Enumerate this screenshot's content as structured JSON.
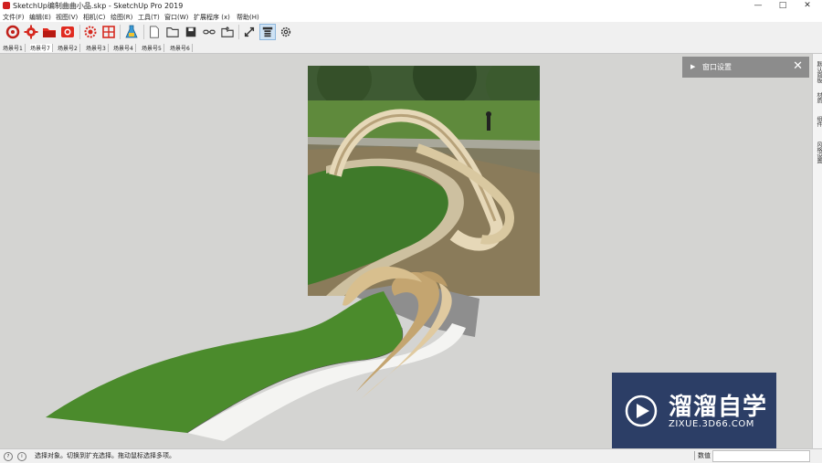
{
  "window": {
    "title": "SketchUp编制曲曲小品.skp - SketchUp Pro 2019",
    "minimize_glyph": "—",
    "maximize_glyph": "□",
    "close_glyph": "✕"
  },
  "menu": {
    "items": [
      "文件(F)",
      "编辑(E)",
      "视图(V)",
      "相机(C)",
      "绘图(R)",
      "工具(T)",
      "窗口(W)",
      "扩展程序 (x)",
      "帮助(H)"
    ]
  },
  "toolbar": {
    "icons": [
      "ruby-icon",
      "gear-icon",
      "folder-icon",
      "screenshot-icon",
      "settings-icon",
      "grid-icon",
      "flask-icon",
      "page-icon",
      "open-folder-icon",
      "save-icon",
      "link-icon",
      "folder-export-icon",
      "resize-icon",
      "panel-icon",
      "cog-icon"
    ]
  },
  "scenes": {
    "tabs": [
      "场景号1",
      "场景号7",
      "场景号2",
      "场景号3",
      "场景号4",
      "场景号5",
      "场景号6"
    ],
    "active_index": 1
  },
  "tray": {
    "title": "窗口设置",
    "tabs": [
      "默认面板",
      "材质",
      "组件",
      "风格设置"
    ]
  },
  "status": {
    "hint": "选择对象。切换到扩充选择。拖动鼠标选择多项。",
    "measurement_label": "数值",
    "measurement_value": ""
  },
  "watermark": {
    "brand": "溜溜自学",
    "url": "ZIXUE.3D66.COM"
  },
  "colors": {
    "viewport_bg": "#d4d4d2",
    "grass": "#4f8f2e",
    "sculpture": "#d9c49a",
    "watermark_bg": "#1c2f5c"
  }
}
